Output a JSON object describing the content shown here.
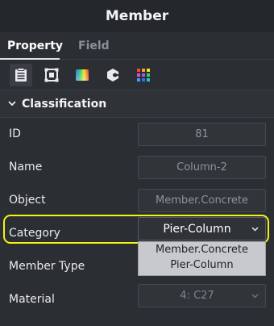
{
  "window": {
    "title": "Member"
  },
  "tabs": [
    {
      "label": "Property",
      "active": true
    },
    {
      "label": "Field",
      "active": false
    }
  ],
  "toolbar": {
    "icons": [
      "document-list-icon",
      "frame-square-icon",
      "color-gradient-icon",
      "cube-refresh-icon",
      "color-grid-icon"
    ]
  },
  "section": {
    "title": "Classification"
  },
  "properties": {
    "id": {
      "label": "ID",
      "value": "81"
    },
    "name": {
      "label": "Name",
      "value": "Column-2"
    },
    "object": {
      "label": "Object",
      "value": "Member.Concrete"
    },
    "category": {
      "label": "Category",
      "value": "Pier-Column",
      "options": [
        "Member.Concrete",
        "Pier-Column"
      ]
    },
    "member_type": {
      "label": "Member Type"
    },
    "material": {
      "label": "Material",
      "value": "4: C27"
    }
  },
  "colors": {
    "highlight": "#f3f317",
    "panel_bg": "#2b2e33",
    "title_bg": "#24272b"
  }
}
